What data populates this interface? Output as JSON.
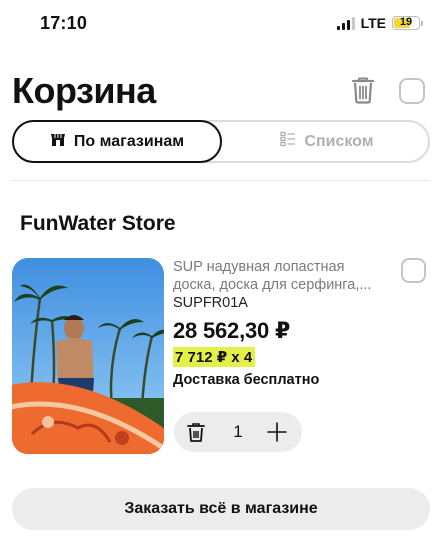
{
  "status_bar": {
    "time": "17:10",
    "network": "LTE",
    "battery": "19",
    "battery_color": "#f1d935"
  },
  "header": {
    "title": "Корзина",
    "icons": [
      "trash-icon",
      "select-all-checkbox"
    ]
  },
  "view_toggle": {
    "options": [
      {
        "label": "По магазинам",
        "icon": "shop-icon",
        "active": true
      },
      {
        "label": "Списком",
        "icon": "list-icon",
        "active": false
      }
    ]
  },
  "store": {
    "name": "FunWater Store",
    "items": [
      {
        "title": "SUP надувная лопастная доска, доска для серфинга,...",
        "sku": "SUPFR01A",
        "price": "28 562,30 ₽",
        "unit_price": "7 712 ₽ x 4",
        "delivery": "Доставка бесплатно",
        "quantity": "1"
      }
    ],
    "order_button": "Заказать всё в магазине"
  },
  "colors": {
    "highlight": "#e4f04a",
    "pill_bg": "#ececec",
    "muted_text": "#7a7a7a"
  }
}
